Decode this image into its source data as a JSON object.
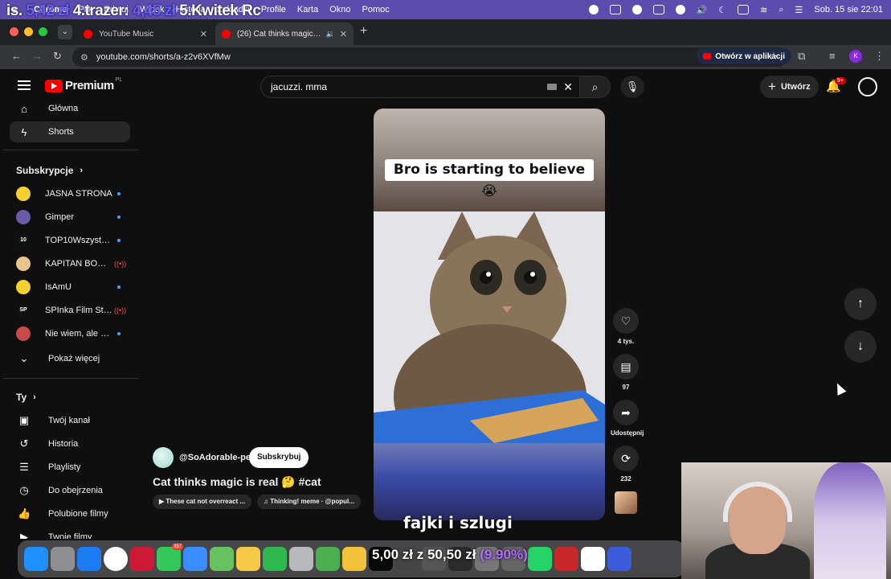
{
  "menubar": {
    "apple": "",
    "items": [
      "Chrome",
      "Plik",
      "Edytuj",
      "Widok",
      "Historia",
      "Zakładki",
      "Profile",
      "Karta",
      "Okno",
      "Pomoc"
    ],
    "datetime": "Sob. 15 sie 22:01",
    "overlay_ticker": {
      "prefix": "is.",
      "v1": "5,42 zł",
      "entry2": "4.trazer:",
      "v2": "4,45 zł",
      "entry3": "5.Kwitek Rc"
    }
  },
  "tabs": [
    {
      "title": "YouTube Music"
    },
    {
      "title": "(26) Cat thinks magic is real"
    }
  ],
  "toolbar": {
    "url": "youtube.com/shorts/a-z2v6XVfMw",
    "open_in_app": "Otwórz w aplikacji",
    "profile_initial": "K"
  },
  "header": {
    "logo_text": "Premium",
    "logo_region": "PL",
    "search_value": "jacuzzi. mma",
    "create_label": "Utwórz",
    "notifications_badge": "9+"
  },
  "sidebar": {
    "main": [
      {
        "label": "Główna",
        "icon": "home-icon"
      },
      {
        "label": "Shorts",
        "icon": "shorts-icon"
      }
    ],
    "subscriptions_heading": "Subskrypcje",
    "subscriptions": [
      {
        "name": "JASNA STRONA",
        "badge": "new",
        "color": "#f5d130",
        "initials": ""
      },
      {
        "name": "Gimper",
        "badge": "new",
        "color": "#6b5aa8",
        "initials": ""
      },
      {
        "name": "TOP10Wszystkie...",
        "badge": "new",
        "color": "#111111",
        "initials": "10"
      },
      {
        "name": "KAPITAN BOMB...",
        "badge": "live",
        "color": "#e7c48a",
        "initials": ""
      },
      {
        "name": "IsAmU",
        "badge": "new",
        "color": "#f5d130",
        "initials": ""
      },
      {
        "name": "SPInka Film Stud...",
        "badge": "live",
        "color": "#111111",
        "initials": "SP"
      },
      {
        "name": "Nie wiem, ale się...",
        "badge": "new",
        "color": "#c84a4a",
        "initials": ""
      }
    ],
    "show_more": "Pokaż więcej",
    "you_heading": "Ty",
    "you": [
      {
        "label": "Twój kanał",
        "icon": "channel-icon"
      },
      {
        "label": "Historia",
        "icon": "history-icon"
      },
      {
        "label": "Playlisty",
        "icon": "playlist-icon"
      },
      {
        "label": "Do obejrzenia",
        "icon": "watch-later-icon"
      },
      {
        "label": "Polubione filmy",
        "icon": "thumbs-up-icon"
      },
      {
        "label": "Twoje filmy",
        "icon": "video-icon"
      }
    ]
  },
  "short": {
    "caption": "Bro is starting to believe 😭",
    "overlay_subtitle": "fajki i szlugi",
    "channel": "@SoAdorable-pet",
    "subscribe_label": "Subskrybuj",
    "title": "Cat thinks magic is real 🤔 #cat",
    "chips": [
      "▶ These cat not overreact ...",
      "♫ Thinking! meme · @popul..."
    ]
  },
  "actions": {
    "likes": "4 tys.",
    "comments": "97",
    "share": "Udostępnij",
    "remix": "232"
  },
  "dock": {
    "badge_count": "357",
    "ticker": {
      "main": "5,00 zł z 50,50 zł",
      "pct": "(9.90%)"
    }
  }
}
